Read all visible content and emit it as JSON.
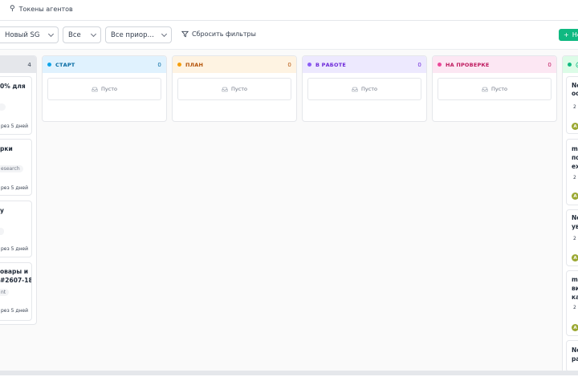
{
  "topbar": {
    "tokens_label": "Токены агентов"
  },
  "filters": {
    "sg": "Новый SG",
    "status": "Все",
    "priority": "Все приор…",
    "reset_label": "Сбросить фильтры"
  },
  "new_button_label": "Не",
  "columns": [
    {
      "key": "start",
      "title": "СТАРТ",
      "count": "0",
      "empty": "Пусто",
      "color": "#0ea5e9",
      "bg": "#e0f2fe"
    },
    {
      "key": "plan",
      "title": "ПЛАН",
      "count": "0",
      "empty": "Пусто",
      "color": "#f59e0b",
      "bg": "#fef3e2"
    },
    {
      "key": "work",
      "title": "В РАБОТЕ",
      "count": "0",
      "empty": "Пусто",
      "color": "#8b5cf6",
      "bg": "#ede9fe"
    },
    {
      "key": "review",
      "title": "НА ПРОВЕРКЕ",
      "count": "0",
      "empty": "Пусто",
      "color": "#ec4899",
      "bg": "#fce7f3"
    }
  ],
  "left_column": {
    "count": "4",
    "cards": [
      {
        "title": "0% для",
        "tag": "",
        "due": "рез 5 дней"
      },
      {
        "title": "рки",
        "tag": "esearch",
        "due": "рез 5 дней"
      },
      {
        "title": "у",
        "tag": "",
        "due": "рез 5 дней"
      },
      {
        "title_1": "овары и",
        "title_2": "#2607-18",
        "tag": "nt",
        "due": "рез 5 дней"
      }
    ]
  },
  "right_column": {
    "cards": [
      {
        "line1": "Ne",
        "line2": "ос",
        "meta": "2",
        "avatar": "A"
      },
      {
        "line1": "ms",
        "line2": "по",
        "line3": "ex",
        "meta": "2",
        "avatar": "A"
      },
      {
        "line1": "Ne",
        "line2": "ув",
        "meta": "2",
        "avatar": "A"
      },
      {
        "line1": "ms",
        "line2": "ви",
        "line3": "ка",
        "meta": "2",
        "avatar": "A"
      },
      {
        "line1": "Ne",
        "line2": "ра"
      }
    ]
  }
}
